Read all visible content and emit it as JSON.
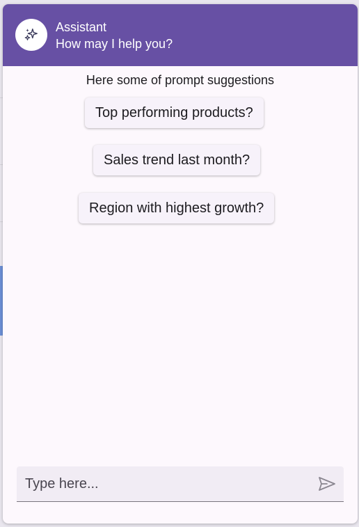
{
  "header": {
    "avatar_icon": "sparkles-icon",
    "title": "Assistant",
    "subtitle": "How may I help you?"
  },
  "suggestions": {
    "heading": "Here some of prompt suggestions",
    "items": [
      "Top performing products?",
      "Sales trend last month?",
      "Region with highest growth?"
    ]
  },
  "composer": {
    "placeholder": "Type here...",
    "value": "",
    "send_icon": "send-icon"
  },
  "colors": {
    "header_bg": "#6750a4",
    "panel_bg": "#fdf8fd",
    "chip_bg": "#f7f2fa",
    "text": "#1c1b1f"
  }
}
